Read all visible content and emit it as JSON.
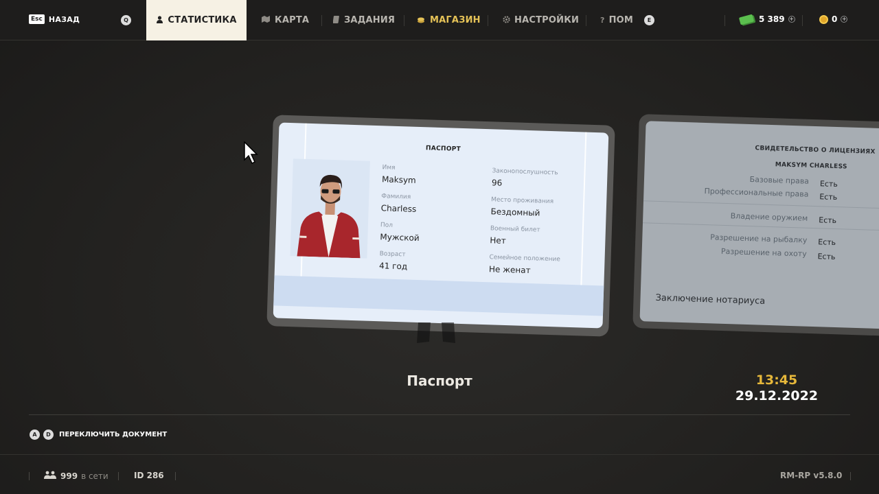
{
  "nav": {
    "back_key": "Esc",
    "back_label": "НАЗАД",
    "left_key": "Q",
    "right_key": "E",
    "tabs": [
      {
        "label": "СТАТИСТИКА",
        "icon": "person-icon",
        "active": true
      },
      {
        "label": "КАРТА",
        "icon": "map-icon"
      },
      {
        "label": "ЗАДАНИЯ",
        "icon": "tasks-icon"
      },
      {
        "label": "МАГАЗИН",
        "icon": "coins-icon"
      },
      {
        "label": "НАСТРОЙКИ",
        "icon": "gear-icon"
      },
      {
        "label": "ПОМ",
        "icon": "question-icon"
      }
    ],
    "cash": "5 389",
    "coins": "0"
  },
  "passport": {
    "title": "ПАСПОРТ",
    "fields": [
      {
        "label": "Имя",
        "value": "Maksym"
      },
      {
        "label": "Фамилия",
        "value": "Charless"
      },
      {
        "label": "Пол",
        "value": "Мужской"
      },
      {
        "label": "Возраст",
        "value": "41 год"
      },
      {
        "label": "Законопослушность",
        "value": "96"
      },
      {
        "label": "Место проживания",
        "value": "Бездомный"
      },
      {
        "label": "Военный билет",
        "value": "Нет"
      },
      {
        "label": "Семейное положение",
        "value": "Не женат"
      }
    ]
  },
  "license": {
    "title": "СВИДЕТЕЛЬСТВО О ЛИЦЕНЗИЯХ",
    "owner": "MAKSYM CHARLESS",
    "rows": [
      {
        "label": "Базовые права",
        "value": "Есть"
      },
      {
        "label": "Профессиональные права",
        "value": "Есть"
      },
      {
        "label": "Владение оружием",
        "value": "Есть"
      },
      {
        "label": "Разрешение на рыбалку",
        "value": "Есть"
      },
      {
        "label": "Разрешение на охоту",
        "value": "Есть"
      }
    ],
    "notary": "Заключение нотариуса"
  },
  "document_name": "Паспорт",
  "clock": {
    "time": "13:45",
    "date": "29.12.2022"
  },
  "switch": {
    "key_a": "A",
    "key_d": "D",
    "label": "ПЕРЕКЛЮЧИТЬ ДОКУМЕНТ"
  },
  "footer": {
    "online_count": "999",
    "online_label": "в сети",
    "id": "ID 286",
    "version": "RM-RP v5.8.0"
  },
  "colors": {
    "accent_gold": "#e5b73a",
    "tab_active_bg": "#f6f1e4",
    "shop": "#e5c257"
  }
}
